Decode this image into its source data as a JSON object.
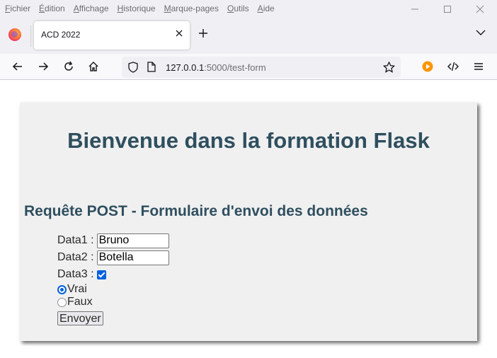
{
  "menu": {
    "items": [
      {
        "u": "F",
        "rest": "ichier"
      },
      {
        "u": "É",
        "rest": "dition"
      },
      {
        "u": "A",
        "rest": "ffichage"
      },
      {
        "u": "H",
        "rest": "istorique"
      },
      {
        "u": "M",
        "rest": "arque-pages"
      },
      {
        "u": "O",
        "rest": "utils"
      },
      {
        "u": "A",
        "rest": "ide"
      }
    ]
  },
  "tab": {
    "title": "ACD 2022"
  },
  "address": {
    "host": "127.0.0.1",
    "rest": ":5000/test-form"
  },
  "page": {
    "heading": "Bienvenue dans la formation Flask",
    "subheading": "Requête POST - Formulaire d'envoi des données",
    "form": {
      "data1_label": "Data1 :",
      "data1_value": "Bruno",
      "data2_label": "Data2 :",
      "data2_value": "Botella",
      "data3_label": "Data3 :",
      "data3_checked": true,
      "radio_true_label": "Vrai",
      "radio_false_label": "Faux",
      "selected_radio": "Vrai",
      "submit_label": "Envoyer"
    }
  },
  "icons": {
    "back": "arrow-left-icon",
    "forward": "arrow-right-icon",
    "reload": "reload-icon",
    "home": "home-icon",
    "shield": "shield-icon",
    "page": "page-icon",
    "bookmark": "star-icon",
    "extension": "play-icon",
    "devtools": "code-icon",
    "menu": "hamburger-icon"
  },
  "colors": {
    "heading": "#2f4f5f",
    "accent": "#0060df",
    "extension": "#ff9500"
  }
}
